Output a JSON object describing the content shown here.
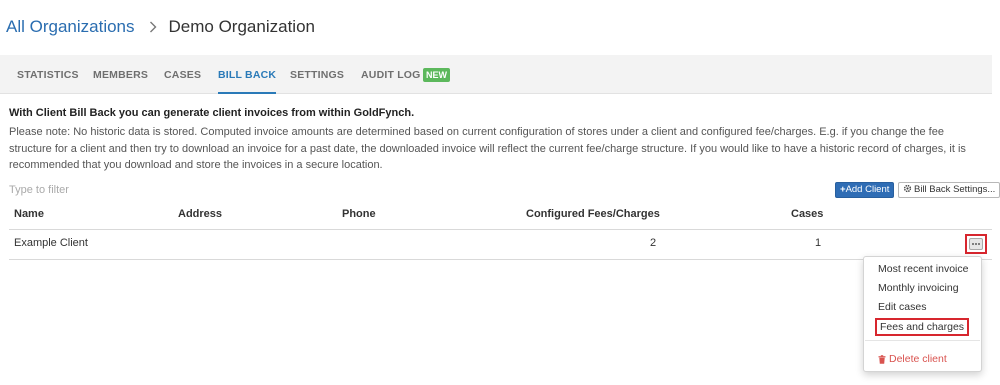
{
  "breadcrumb": {
    "parent": "All Organizations",
    "current": "Demo Organization"
  },
  "tabs": [
    {
      "label": "STATISTICS",
      "active": false
    },
    {
      "label": "MEMBERS",
      "active": false
    },
    {
      "label": "CASES",
      "active": false
    },
    {
      "label": "BILL BACK",
      "active": true
    },
    {
      "label": "SETTINGS",
      "active": false
    },
    {
      "label": "AUDIT LOG",
      "active": false
    }
  ],
  "audit_badge": "NEW",
  "intro": "With Client Bill Back you can generate client invoices from within GoldFynch.",
  "note": "Please note: No historic data is stored. Computed invoice amounts are determined based on current configuration of stores under a client and configured fee/charges. E.g. if you change the fee structure for a client and then try to download an invoice for a past date, the downloaded invoice will reflect the current fee/charge structure. If you would like to have a historic record of charges, it is recommended that you download and store the invoices in a secure location.",
  "filter": {
    "placeholder": "Type to filter",
    "value": ""
  },
  "buttons": {
    "add_client": "Add Client",
    "settings": "Bill Back Settings..."
  },
  "table": {
    "headers": [
      "Name",
      "Address",
      "Phone",
      "Configured Fees/Charges",
      "Cases"
    ],
    "rows": [
      {
        "name": "Example Client",
        "address": "",
        "phone": "",
        "fees": "2",
        "cases": "1"
      }
    ]
  },
  "row_menu": {
    "items": [
      "Most recent invoice",
      "Monthly invoicing",
      "Edit cases",
      "Fees and charges"
    ],
    "delete": "Delete client"
  },
  "colors": {
    "link": "#2a6db0",
    "active_tab": "#2a7ab8",
    "badge": "#5cb85c",
    "primary_button": "#2f6db5",
    "highlight": "#d7262e",
    "danger": "#d9534f"
  },
  "icons": [
    "chevron-right-icon",
    "plus-icon",
    "gear-icon",
    "ellipsis-icon",
    "trash-icon"
  ]
}
